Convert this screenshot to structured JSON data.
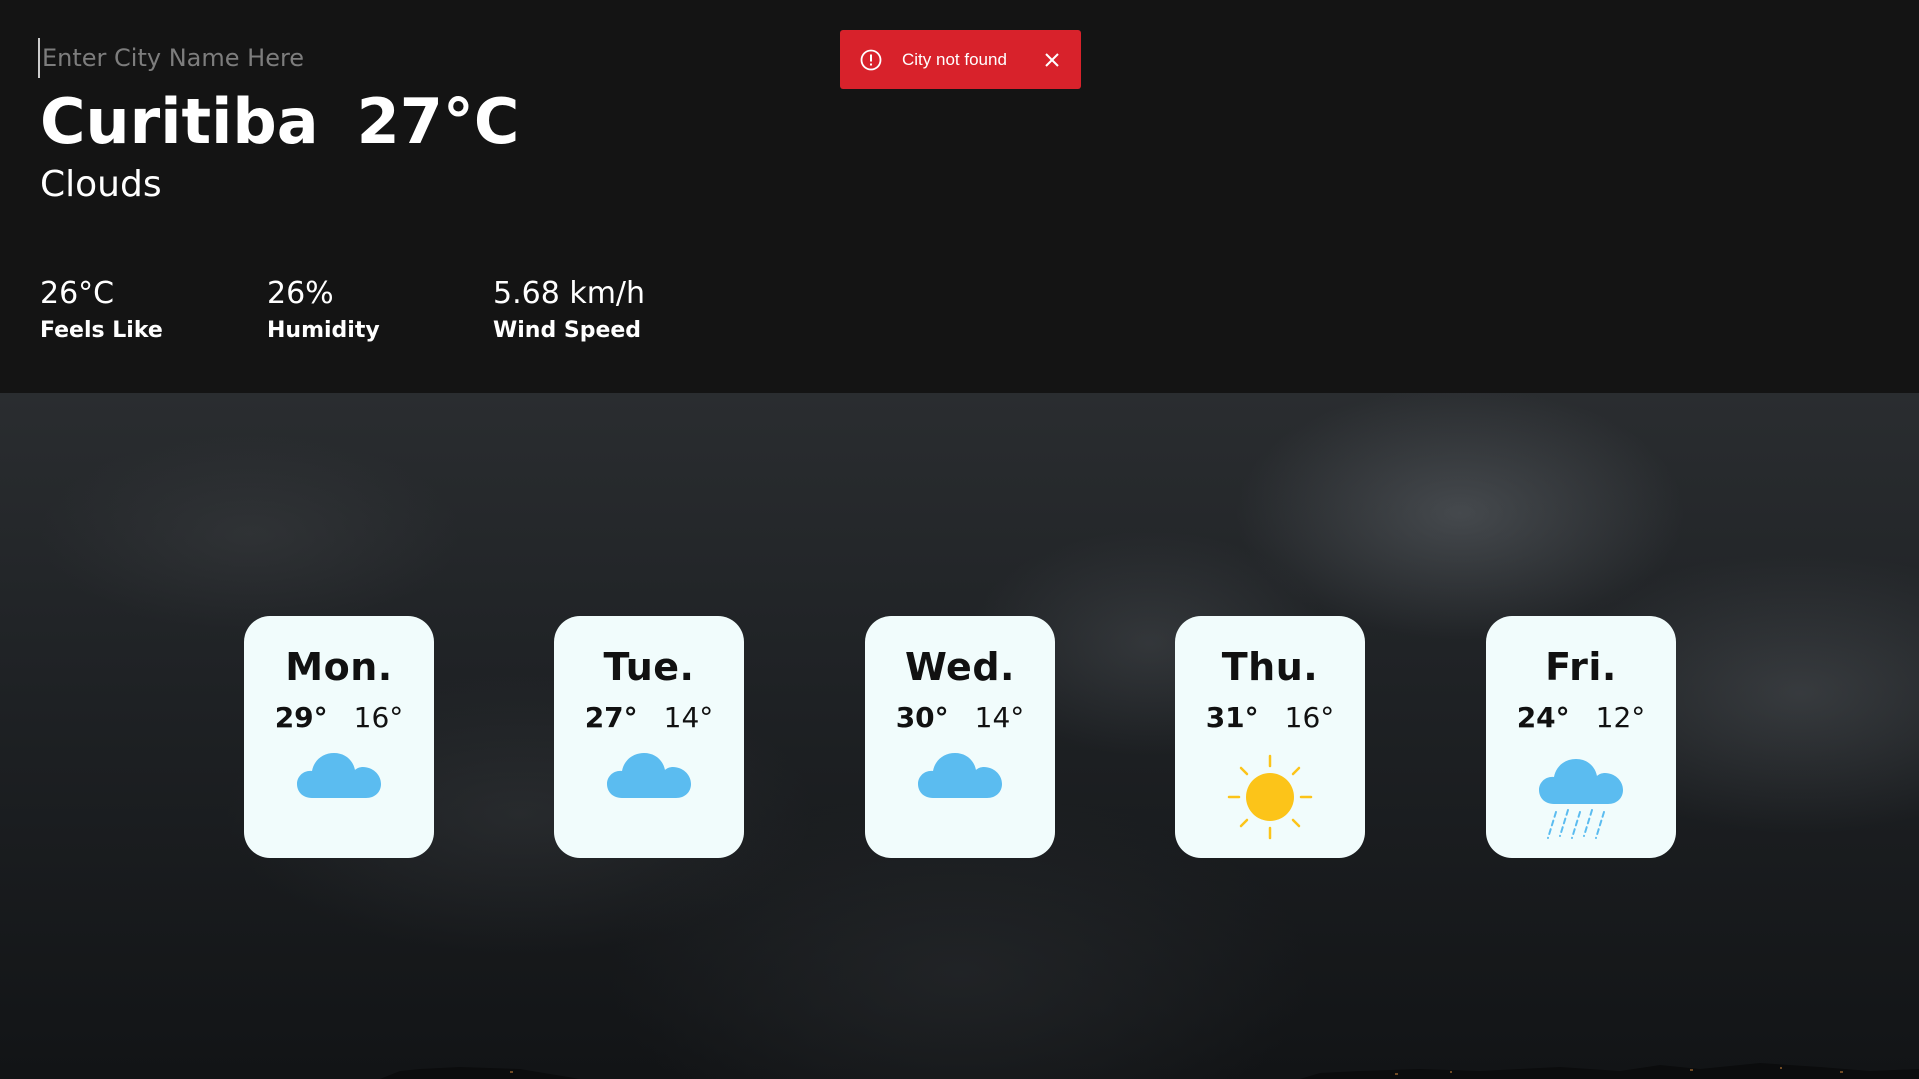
{
  "search": {
    "placeholder": "Enter City Name Here"
  },
  "current": {
    "city": "Curitiba",
    "temperature": "27°C",
    "condition": "Clouds"
  },
  "stats": [
    {
      "value": "26°C",
      "label": "Feels Like"
    },
    {
      "value": "26%",
      "label": "Humidity"
    },
    {
      "value": "5.68 km/h",
      "label": "Wind Speed"
    }
  ],
  "toast": {
    "message": "City not found",
    "color": "#d8222b",
    "icon": "alert-circle-icon",
    "close_icon": "close-icon"
  },
  "forecast": [
    {
      "day": "Mon.",
      "high": "29°",
      "low": "16°",
      "icon": "cloud-icon"
    },
    {
      "day": "Tue.",
      "high": "27°",
      "low": "14°",
      "icon": "cloud-icon"
    },
    {
      "day": "Wed.",
      "high": "30°",
      "low": "14°",
      "icon": "cloud-icon"
    },
    {
      "day": "Thu.",
      "high": "31°",
      "low": "16°",
      "icon": "sun-icon"
    },
    {
      "day": "Fri.",
      "high": "24°",
      "low": "12°",
      "icon": "rain-cloud-icon"
    }
  ],
  "colors": {
    "card_background": "#f1fcfc",
    "cloud": "#5bbcf0",
    "sun": "#fcc419",
    "page_background": "#141414"
  }
}
